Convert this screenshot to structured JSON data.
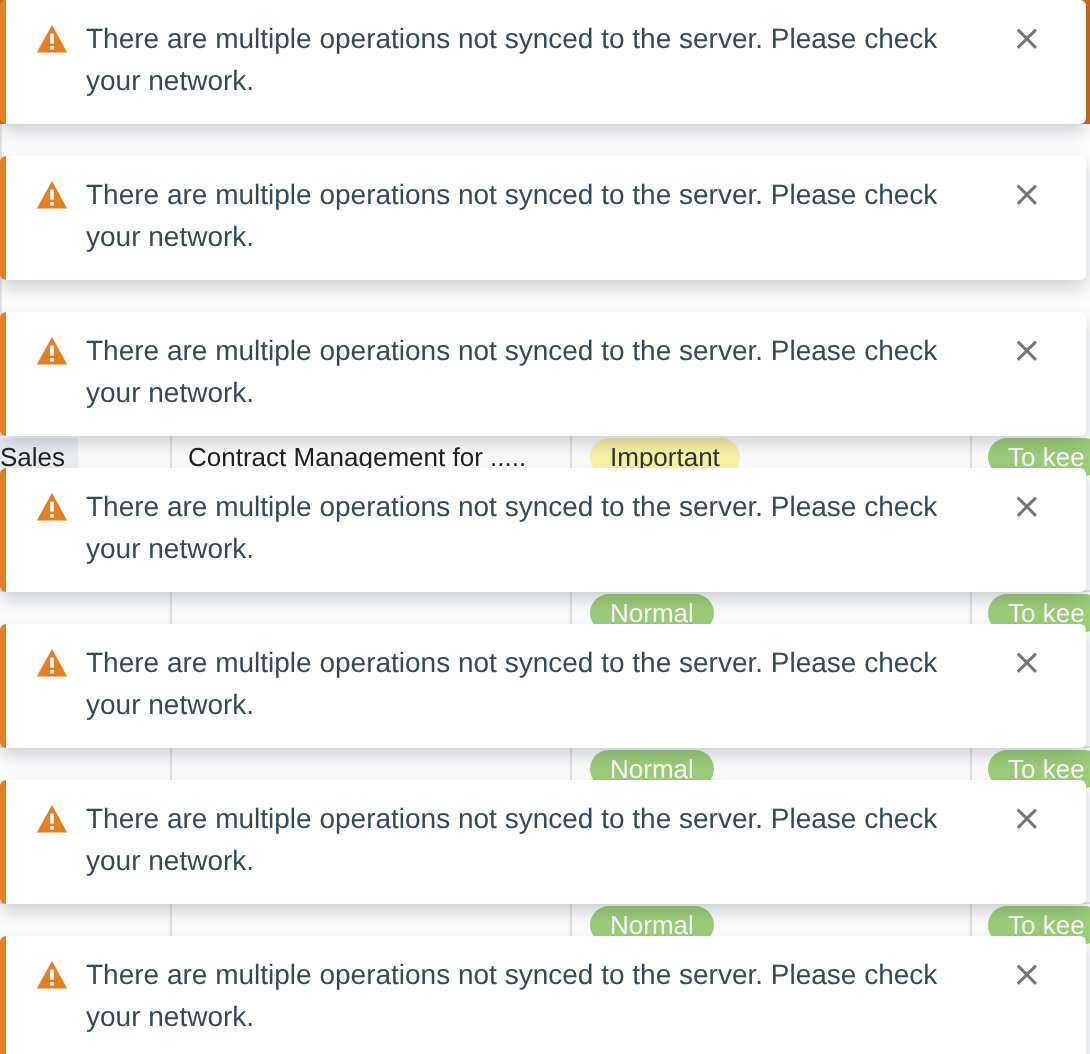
{
  "table": {
    "rows": [
      {
        "department": "Sales",
        "subject": "Contract Management for .....",
        "priority": {
          "label": "Important",
          "kind": "important"
        },
        "status": "To kee"
      },
      {
        "priority": {
          "label": "Normal",
          "kind": "normal"
        },
        "status": "To kee"
      },
      {
        "priority": {
          "label": "Normal",
          "kind": "normal"
        },
        "status": "To kee"
      },
      {
        "priority": {
          "label": "Normal",
          "kind": "normal"
        },
        "status": "To kee"
      }
    ]
  },
  "notifications": [
    {
      "kind": "warning",
      "message": "There are multiple operations not synced to the server. Please check your network.",
      "close": "×"
    },
    {
      "kind": "warning",
      "message": "There are multiple operations not synced to the server. Please check your network.",
      "close": "×"
    },
    {
      "kind": "warning",
      "message": "There are multiple operations not synced to the server. Please check your network.",
      "close": "×"
    },
    {
      "kind": "warning",
      "message": "There are multiple operations not synced to the server. Please check your network.",
      "close": "×"
    },
    {
      "kind": "warning",
      "message": "There are multiple operations not synced to the server. Please check your network.",
      "close": "×"
    },
    {
      "kind": "warning",
      "message": "There are multiple operations not synced to the server. Please check your network.",
      "close": "×"
    },
    {
      "kind": "warning",
      "message": "There are multiple operations not synced to the server. Please check your network.",
      "close": "×"
    }
  ]
}
